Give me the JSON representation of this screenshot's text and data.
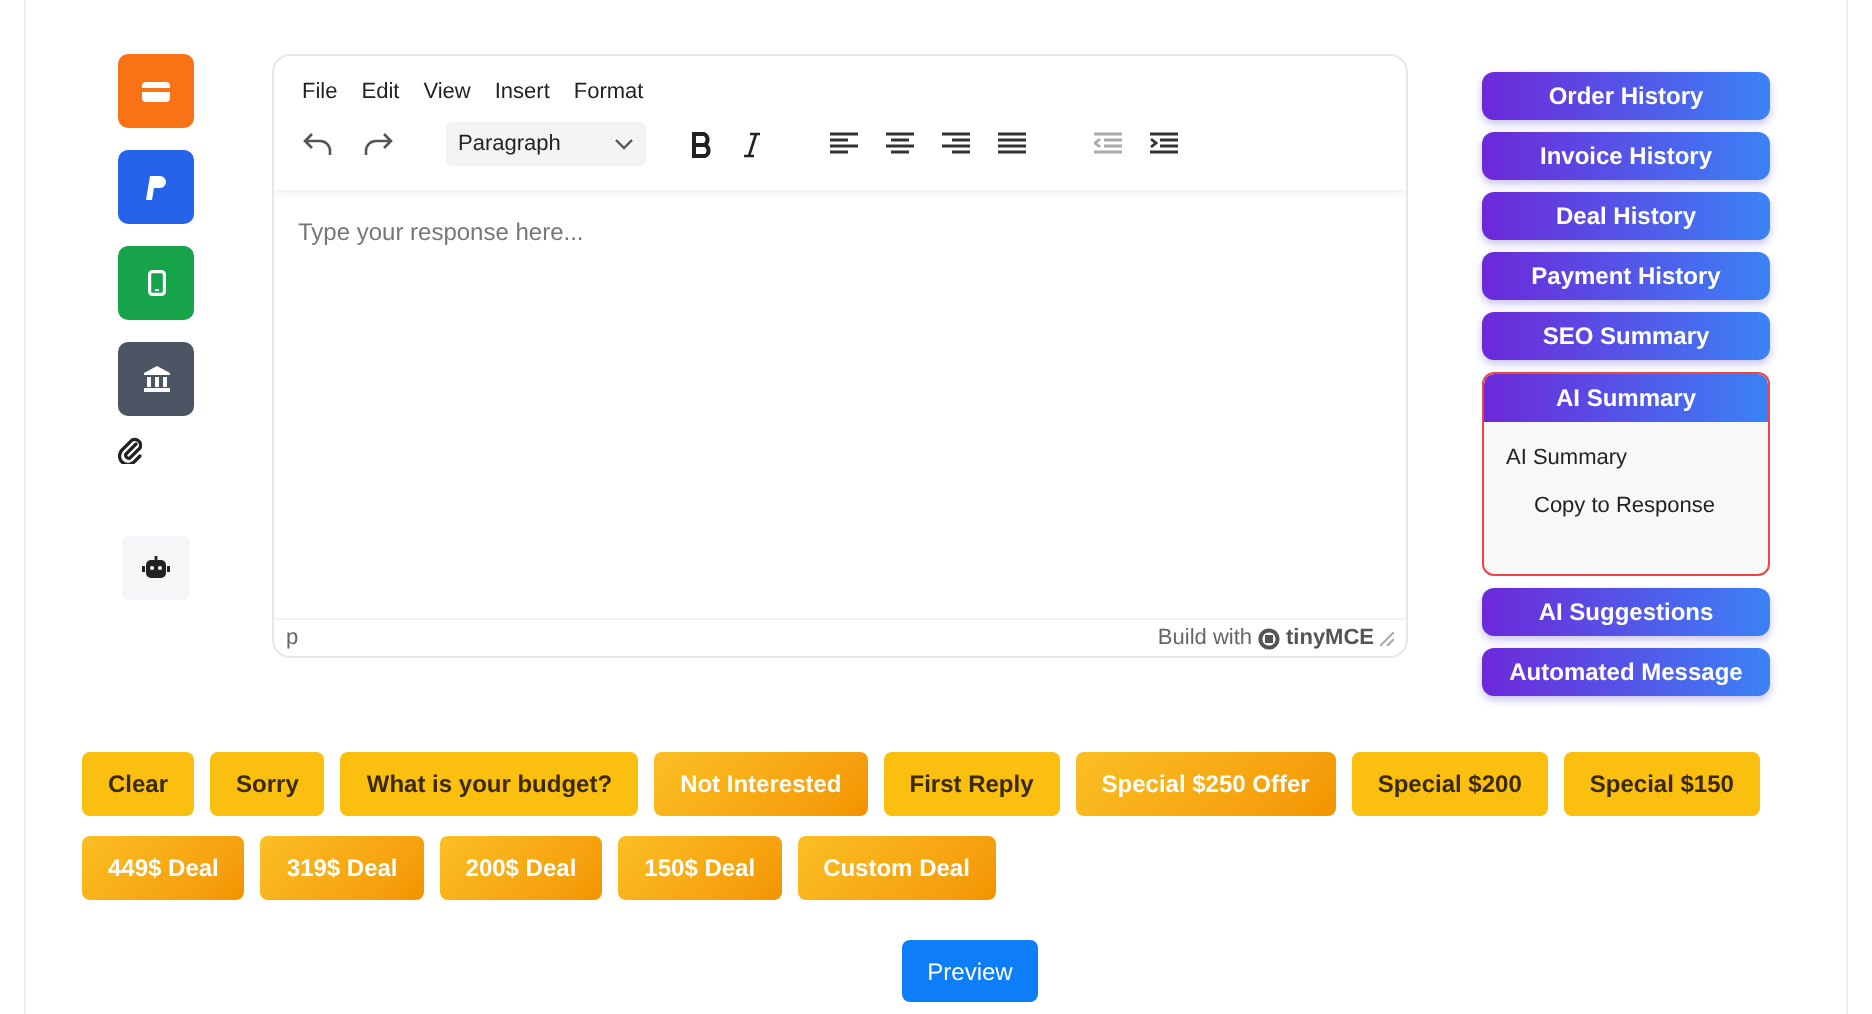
{
  "side_icons": [
    {
      "kind": "card",
      "color": "#f97316"
    },
    {
      "kind": "paypal",
      "color": "#2563eb"
    },
    {
      "kind": "phone",
      "color": "#16a34a"
    },
    {
      "kind": "bank",
      "color": "#4b5563"
    },
    {
      "kind": "clip"
    },
    {
      "kind": "robot"
    }
  ],
  "editor": {
    "menu": [
      "File",
      "Edit",
      "View",
      "Insert",
      "Format"
    ],
    "block_format": "Paragraph",
    "placeholder": "Type your response here...",
    "path": "p",
    "branding": "Build with",
    "brand": "tinyMCE"
  },
  "actions": [
    {
      "label": "Order History",
      "expanded": false
    },
    {
      "label": "Invoice History",
      "expanded": false
    },
    {
      "label": "Deal History",
      "expanded": false
    },
    {
      "label": "Payment History",
      "expanded": false
    },
    {
      "label": "SEO Summary",
      "expanded": false
    },
    {
      "label": "AI Summary",
      "expanded": true,
      "panel_text": "AI Summary",
      "panel_button": "Copy to Response"
    },
    {
      "label": "AI Suggestions",
      "expanded": false
    },
    {
      "label": "Automated Message",
      "expanded": false
    }
  ],
  "quick_rows": [
    [
      {
        "label": "Clear",
        "kind": "plain"
      },
      {
        "label": "Sorry",
        "kind": "plain"
      },
      {
        "label": "What is your budget?",
        "kind": "plain"
      },
      {
        "label": "Not Interested",
        "kind": "deal"
      },
      {
        "label": "First Reply",
        "kind": "plain"
      },
      {
        "label": "Special $250 Offer",
        "kind": "deal"
      },
      {
        "label": "Special $200",
        "kind": "plain"
      },
      {
        "label": "Special $150",
        "kind": "plain"
      }
    ],
    [
      {
        "label": "449$ Deal",
        "kind": "deal"
      },
      {
        "label": "319$ Deal",
        "kind": "deal"
      },
      {
        "label": "200$ Deal",
        "kind": "deal"
      },
      {
        "label": "150$ Deal",
        "kind": "deal"
      },
      {
        "label": "Custom Deal",
        "kind": "deal"
      }
    ]
  ],
  "preview_button": "Preview"
}
